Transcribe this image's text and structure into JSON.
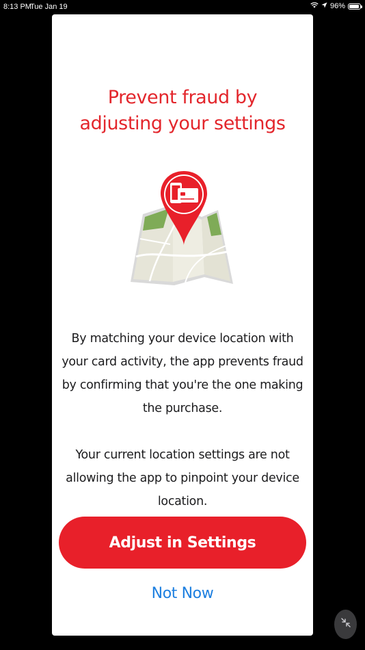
{
  "status_bar": {
    "time": "8:13 PM",
    "date": "Tue Jan 19",
    "battery": "96%",
    "battery_level": 0.96,
    "icons": [
      "wifi-icon",
      "location-arrow-icon",
      "battery-icon"
    ]
  },
  "modal": {
    "title": "Prevent fraud by adjusting your settings",
    "illustration": "map-location-pin-icon",
    "paragraph_1": "By matching your device location with your card activity, the app prevents fraud by confirming that you're the one making the purchase.",
    "paragraph_2": "Your current location settings are not allowing the app to pinpoint your device location.",
    "primary_button": "Adjust in Settings",
    "secondary_link": "Not Now"
  },
  "floating_button": {
    "icon": "collapse-arrows-icon"
  },
  "colors": {
    "accent_red": "#e8202a",
    "title_red": "#e3262c",
    "link_blue": "#1d7fe0",
    "background": "#000000",
    "card": "#ffffff"
  }
}
